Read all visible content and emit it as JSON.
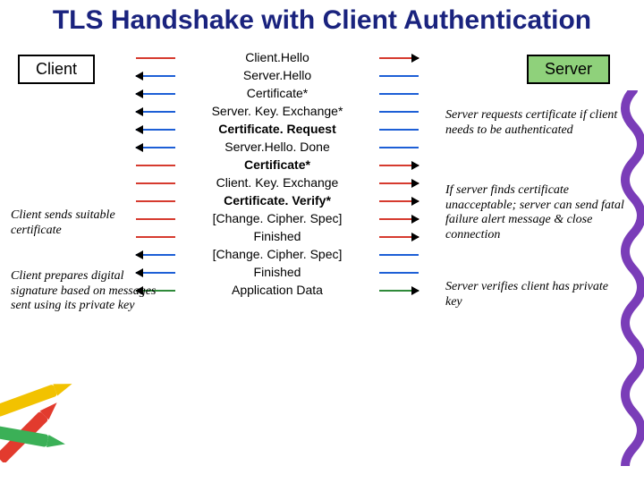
{
  "title": "TLS Handshake with Client Authentication",
  "client_label": "Client",
  "server_label": "Server",
  "messages": [
    {
      "label": "Client.Hello",
      "dir": "s",
      "color": "red",
      "bold": false
    },
    {
      "label": "Server.Hello",
      "dir": "c",
      "color": "blue",
      "bold": false
    },
    {
      "label": "Certificate*",
      "dir": "c",
      "color": "blue",
      "bold": false
    },
    {
      "label": "Server. Key. Exchange*",
      "dir": "c",
      "color": "blue",
      "bold": false
    },
    {
      "label": "Certificate. Request",
      "dir": "c",
      "color": "blue",
      "bold": true
    },
    {
      "label": "Server.Hello. Done",
      "dir": "c",
      "color": "blue",
      "bold": false
    },
    {
      "label": "Certificate*",
      "dir": "s",
      "color": "red",
      "bold": true
    },
    {
      "label": "Client. Key. Exchange",
      "dir": "s",
      "color": "red",
      "bold": false
    },
    {
      "label": "Certificate. Verify*",
      "dir": "s",
      "color": "red",
      "bold": true
    },
    {
      "label": "[Change. Cipher. Spec]",
      "dir": "s",
      "color": "red",
      "bold": false
    },
    {
      "label": "Finished",
      "dir": "s",
      "color": "red",
      "bold": false
    },
    {
      "label": "[Change. Cipher. Spec]",
      "dir": "c",
      "color": "blue",
      "bold": false
    },
    {
      "label": "Finished",
      "dir": "c",
      "color": "blue",
      "bold": false
    },
    {
      "label": "Application Data",
      "dir": "b",
      "color": "green",
      "bold": false
    }
  ],
  "note_left_1": "Client sends suitable certificate",
  "note_left_2": "Client prepares digital signature based on messages sent using its private key",
  "note_right_1": "Server requests certificate if client needs to be authenticated",
  "note_right_2": "If server finds certificate unacceptable; server can send fatal failure alert message & close connection",
  "note_right_3": "Server verifies client has private key"
}
